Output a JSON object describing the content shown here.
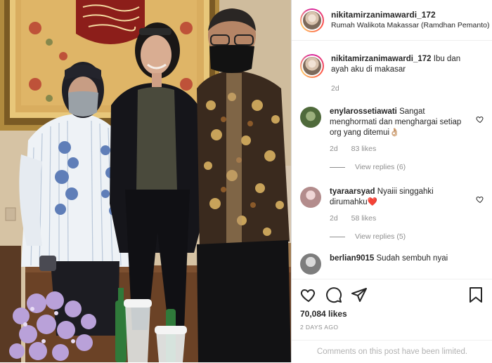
{
  "post": {
    "username": "nikitamirzanimawardi_172",
    "location": "Rumah Walikota Makassar (Ramdhan Pemanto)",
    "caption": {
      "username": "nikitamirzanimawardi_172",
      "text": "Ibu dan ayah aku di makasar",
      "time": "2d"
    }
  },
  "comments": [
    {
      "username": "enylarossetiawati",
      "text": "Sangat menghormati dan menghargai setiap org yang ditemui👌🏼",
      "time": "2d",
      "likes": "83 likes",
      "view_replies": "View replies (6)"
    },
    {
      "username": "tyaraarsyad",
      "text": "Nyaiii singgahki dirumahku❤️",
      "time": "2d",
      "likes": "58 likes",
      "view_replies": "View replies (5)"
    },
    {
      "username": "berlian9015",
      "text": "Sudah sembuh nyai"
    }
  ],
  "actions": {
    "icons": [
      "heart-icon",
      "comment-icon",
      "share-icon",
      "bookmark-icon"
    ],
    "likes": "70,084 likes",
    "date": "2 DAYS AGO",
    "comments_limited": "Comments on this post have been limited."
  },
  "colors": {
    "text": "#262626",
    "secondary": "#8e8e8e",
    "heart_red": "#ed4956",
    "border": "#dbdbdb"
  }
}
